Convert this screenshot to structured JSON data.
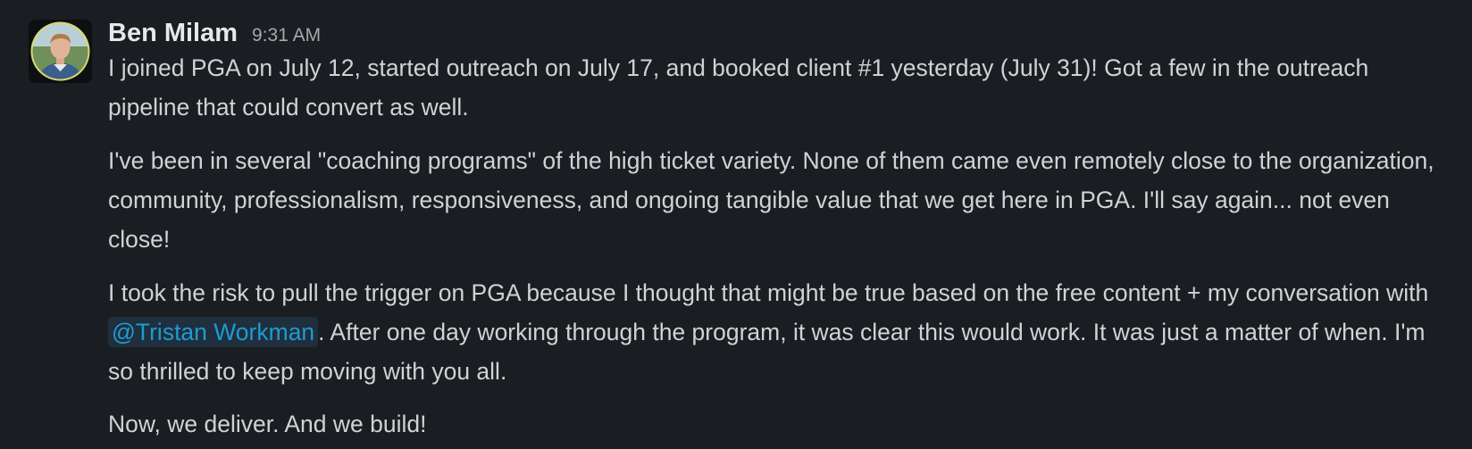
{
  "message": {
    "sender": "Ben Milam",
    "timestamp": "9:31 AM",
    "avatar_icon": "user-photo-avatar",
    "mention_color": "#1d9bd1",
    "paragraphs": {
      "p1": "I joined PGA on July 12, started outreach on July 17, and booked client #1 yesterday (July 31)! Got a few in the outreach pipeline that could convert as well.",
      "p2": "I've been in several \"coaching programs\" of the high ticket variety. None of them came even remotely close to the organization, community, professionalism, responsiveness, and ongoing tangible value that we get here in PGA. I'll say again... not even close!",
      "p3_before": "I took the risk to pull the trigger on PGA because I thought that might be true based on the free content + my conversation with ",
      "p3_mention": "@Tristan Workman",
      "p3_after": ". After one day working through the program, it was clear this would work. It was just a matter of when. I'm so thrilled to keep moving with you all.",
      "p4": "Now, we deliver. And we build!"
    }
  }
}
